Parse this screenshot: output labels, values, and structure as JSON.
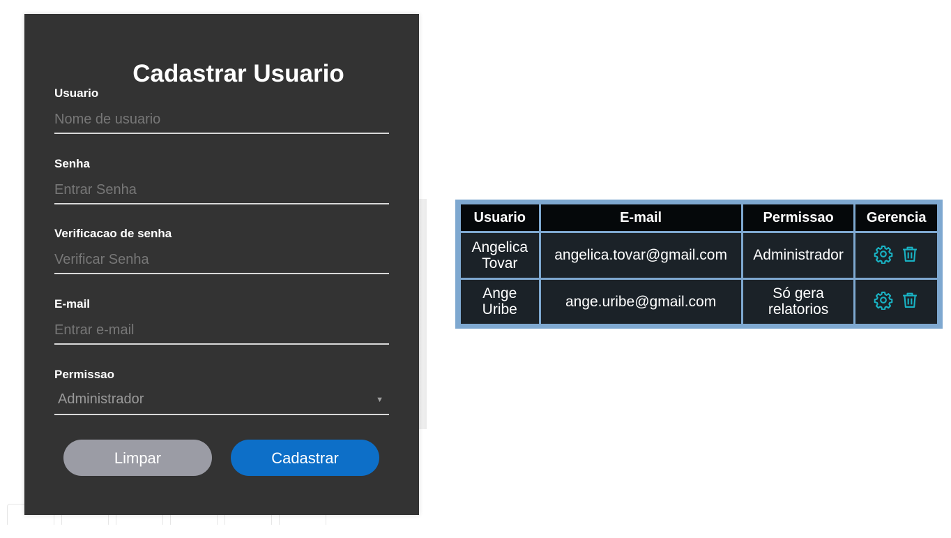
{
  "form": {
    "title": "Cadastrar Usuario",
    "fields": [
      {
        "label": "Usuario",
        "placeholder": "Nome de usuario",
        "value": ""
      },
      {
        "label": "Senha",
        "placeholder": "Entrar Senha",
        "value": ""
      },
      {
        "label": "Verificacao de senha",
        "placeholder": "Verificar Senha",
        "value": ""
      },
      {
        "label": "E-mail",
        "placeholder": "Entrar e-mail",
        "value": ""
      }
    ],
    "permission": {
      "label": "Permissao",
      "selected": "Administrador"
    },
    "buttons": {
      "clear": "Limpar",
      "submit": "Cadastrar"
    }
  },
  "table": {
    "headers": [
      "Usuario",
      "E-mail",
      "Permissao",
      "Gerencia"
    ],
    "rows": [
      {
        "user": "Angelica Tovar",
        "email": "angelica.tovar@gmail.com",
        "permission": "Administrador"
      },
      {
        "user": "Ange Uribe",
        "email": "ange.uribe@gmail.com",
        "permission": "Só gera relatorios"
      }
    ],
    "icons": {
      "settings": "gear-icon",
      "delete": "trash-icon"
    }
  },
  "colors": {
    "panel_bg": "#333333",
    "clear_button": "#9b9ca5",
    "submit_button": "#0d6fc8",
    "table_frame": "#7ea8d0",
    "table_header_bg": "#05080a",
    "table_cell_bg": "#1b2228",
    "action_icon": "#19b3c4"
  }
}
